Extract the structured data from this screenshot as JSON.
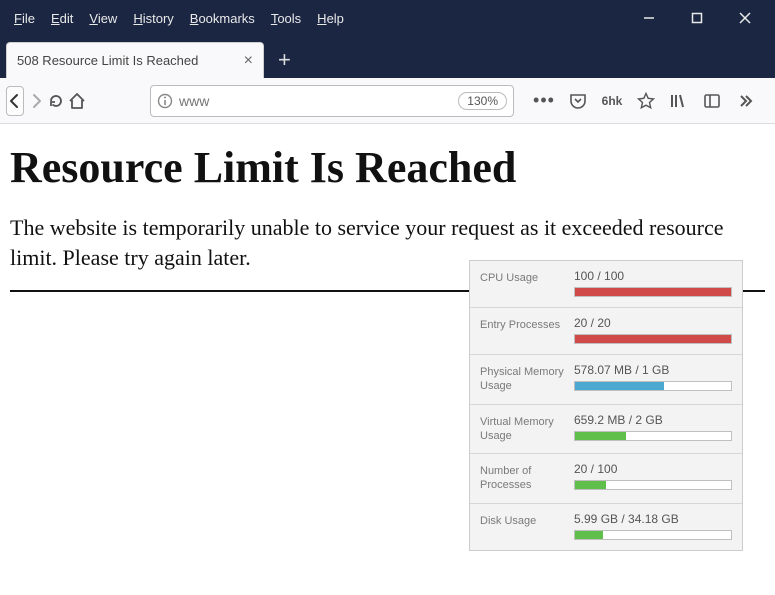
{
  "menubar": {
    "file": "File",
    "edit": "Edit",
    "view": "View",
    "history": "History",
    "bookmarks": "Bookmarks",
    "tools": "Tools",
    "help": "Help"
  },
  "tab": {
    "title": "508 Resource Limit Is Reached"
  },
  "urlbar": {
    "placeholder": "www",
    "zoom": "130%",
    "badge": "6hk"
  },
  "page": {
    "heading": "Resource Limit Is Reached",
    "paragraph": "The website is temporarily unable to service your request as it exceeded resource limit. Please try again later."
  },
  "panel": {
    "rows": [
      {
        "label": "CPU Usage",
        "value": "100 / 100",
        "pct": 100,
        "color": "#d14a4a"
      },
      {
        "label": "Entry Processes",
        "value": "20 / 20",
        "pct": 100,
        "color": "#d14a4a"
      },
      {
        "label": "Physical Memory Usage",
        "value": "578.07 MB / 1 GB",
        "pct": 57,
        "color": "#4aa8d1"
      },
      {
        "label": "Virtual Memory Usage",
        "value": "659.2 MB / 2 GB",
        "pct": 33,
        "color": "#5fbf4a"
      },
      {
        "label": "Number of Processes",
        "value": "20 / 100",
        "pct": 20,
        "color": "#5fbf4a"
      },
      {
        "label": "Disk Usage",
        "value": "5.99 GB / 34.18 GB",
        "pct": 18,
        "color": "#5fbf4a"
      }
    ]
  }
}
